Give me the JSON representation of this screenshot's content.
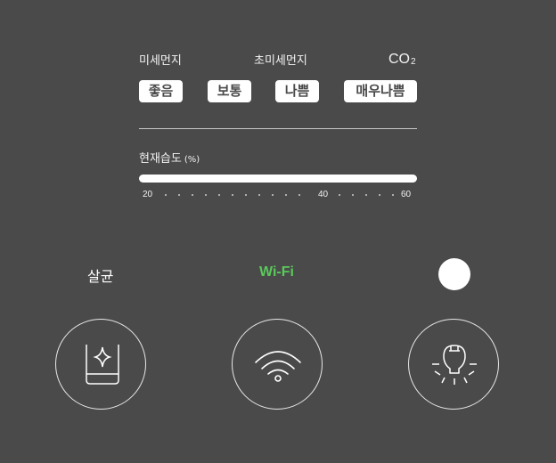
{
  "sensors": {
    "pm10_label": "미세먼지",
    "pm25_label": "초미세먼지",
    "co2_label": "CO",
    "co2_subscript": "2"
  },
  "levels": [
    "좋음",
    "보통",
    "나쁨",
    "매우나쁨"
  ],
  "humidity": {
    "title": "현재습도",
    "unit": "(%)",
    "scale": [
      "20",
      "40",
      "60"
    ]
  },
  "status": {
    "sterilize_label": "살균",
    "wifi_label": "Wi-Fi",
    "wifi_color": "#59c95a"
  },
  "buttons": {
    "sterilize_icon": "sterilize-cup-sparkle-icon",
    "wifi_icon": "wifi-icon",
    "light_icon": "light-bulb-icon"
  }
}
